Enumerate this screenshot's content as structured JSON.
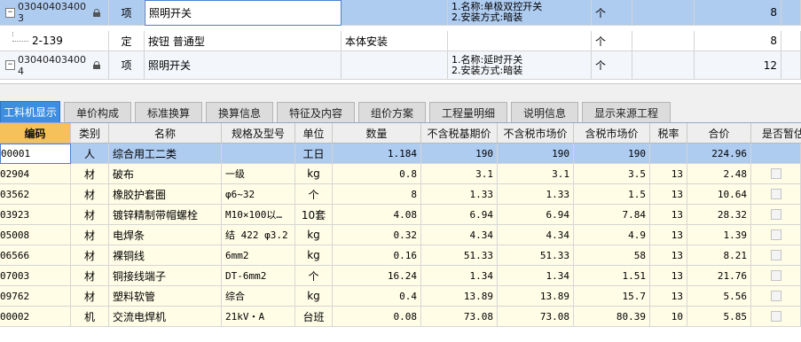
{
  "top_rows": [
    {
      "code_line1": "03040403400",
      "code_line2": "3",
      "expander": "−",
      "locked": true,
      "type": "项",
      "name": "照明开关",
      "feature_line1": "1.名称:单极双控开关",
      "feature_line2": "2.安装方式:暗装",
      "unit": "个",
      "qty": "8",
      "selected": true
    },
    {
      "code": "2-139",
      "type": "定",
      "name": "按钮 普通型",
      "content": "本体安装",
      "unit": "个",
      "qty": "8"
    },
    {
      "code_line1": "03040403400",
      "code_line2": "4",
      "expander": "−",
      "locked": true,
      "type": "项",
      "name": "照明开关",
      "feature_line1": "1.名称:延时开关",
      "feature_line2": "2.安装方式:暗装",
      "unit": "个",
      "qty": "12"
    }
  ],
  "tabs": [
    {
      "label": "工料机显示",
      "active": true
    },
    {
      "label": "单价构成"
    },
    {
      "label": "标准换算"
    },
    {
      "label": "换算信息"
    },
    {
      "label": "特征及内容"
    },
    {
      "label": "组价方案"
    },
    {
      "label": "工程量明细"
    },
    {
      "label": "说明信息"
    },
    {
      "label": "显示来源工程"
    }
  ],
  "columns": [
    "编码",
    "类别",
    "名称",
    "规格及型号",
    "单位",
    "数量",
    "不含税基期价",
    "不含税市场价",
    "含税市场价",
    "税率",
    "合价",
    "是否暂估"
  ],
  "rows": [
    {
      "code": "00001",
      "cat": "人",
      "name": "综合用工二类",
      "spec": "",
      "unit": "工日",
      "qty": "1.184",
      "base": "190",
      "market": "190",
      "taxed": "190",
      "rate": "",
      "total": "224.96"
    },
    {
      "code": "02904",
      "cat": "材",
      "name": "破布",
      "spec": "一级",
      "unit": "kg",
      "qty": "0.8",
      "base": "3.1",
      "market": "3.1",
      "taxed": "3.5",
      "rate": "13",
      "total": "2.48"
    },
    {
      "code": "03562",
      "cat": "材",
      "name": "橡胶护套圈",
      "spec": "φ6~32",
      "unit": "个",
      "qty": "8",
      "base": "1.33",
      "market": "1.33",
      "taxed": "1.5",
      "rate": "13",
      "total": "10.64"
    },
    {
      "code": "03923",
      "cat": "材",
      "name": "镀锌精制带帽螺栓",
      "spec": "M10×100以…",
      "unit": "10套",
      "qty": "4.08",
      "base": "6.94",
      "market": "6.94",
      "taxed": "7.84",
      "rate": "13",
      "total": "28.32"
    },
    {
      "code": "05008",
      "cat": "材",
      "name": "电焊条",
      "spec": "结 422 φ3.2",
      "unit": "kg",
      "qty": "0.32",
      "base": "4.34",
      "market": "4.34",
      "taxed": "4.9",
      "rate": "13",
      "total": "1.39"
    },
    {
      "code": "06566",
      "cat": "材",
      "name": "裸铜线",
      "spec": "6mm2",
      "unit": "kg",
      "qty": "0.16",
      "base": "51.33",
      "market": "51.33",
      "taxed": "58",
      "rate": "13",
      "total": "8.21"
    },
    {
      "code": "07003",
      "cat": "材",
      "name": "铜接线端子",
      "spec": "DT-6mm2",
      "unit": "个",
      "qty": "16.24",
      "base": "1.34",
      "market": "1.34",
      "taxed": "1.51",
      "rate": "13",
      "total": "21.76"
    },
    {
      "code": "09762",
      "cat": "材",
      "name": "塑料软管",
      "spec": "综合",
      "unit": "kg",
      "qty": "0.4",
      "base": "13.89",
      "market": "13.89",
      "taxed": "15.7",
      "rate": "13",
      "total": "5.56"
    },
    {
      "code": "00002",
      "cat": "机",
      "name": "交流电焊机",
      "spec": "21kV・A",
      "unit": "台班",
      "qty": "0.08",
      "base": "73.08",
      "market": "73.08",
      "taxed": "80.39",
      "rate": "10",
      "total": "5.85"
    }
  ]
}
